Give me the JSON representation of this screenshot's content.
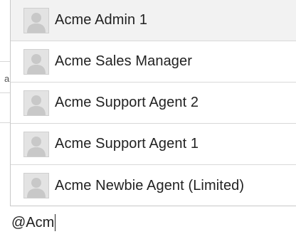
{
  "background": {
    "partial_glyph": "a"
  },
  "mention_list": {
    "selected_index": 0,
    "items": [
      {
        "name": "Acme Admin 1",
        "avatar_icon": "user-placeholder-icon"
      },
      {
        "name": "Acme Sales Manager",
        "avatar_icon": "user-placeholder-icon"
      },
      {
        "name": "Acme Support Agent 2",
        "avatar_icon": "user-placeholder-icon"
      },
      {
        "name": "Acme Support Agent 1",
        "avatar_icon": "user-placeholder-icon"
      },
      {
        "name": "Acme Newbie Agent (Limited)",
        "avatar_icon": "user-placeholder-icon"
      }
    ]
  },
  "composer": {
    "text": "@Acm"
  },
  "colors": {
    "selected_row": "#f2f2f2",
    "divider": "#d9d9d9",
    "text": "#222222",
    "avatar_bg": "#e3e3e3"
  }
}
